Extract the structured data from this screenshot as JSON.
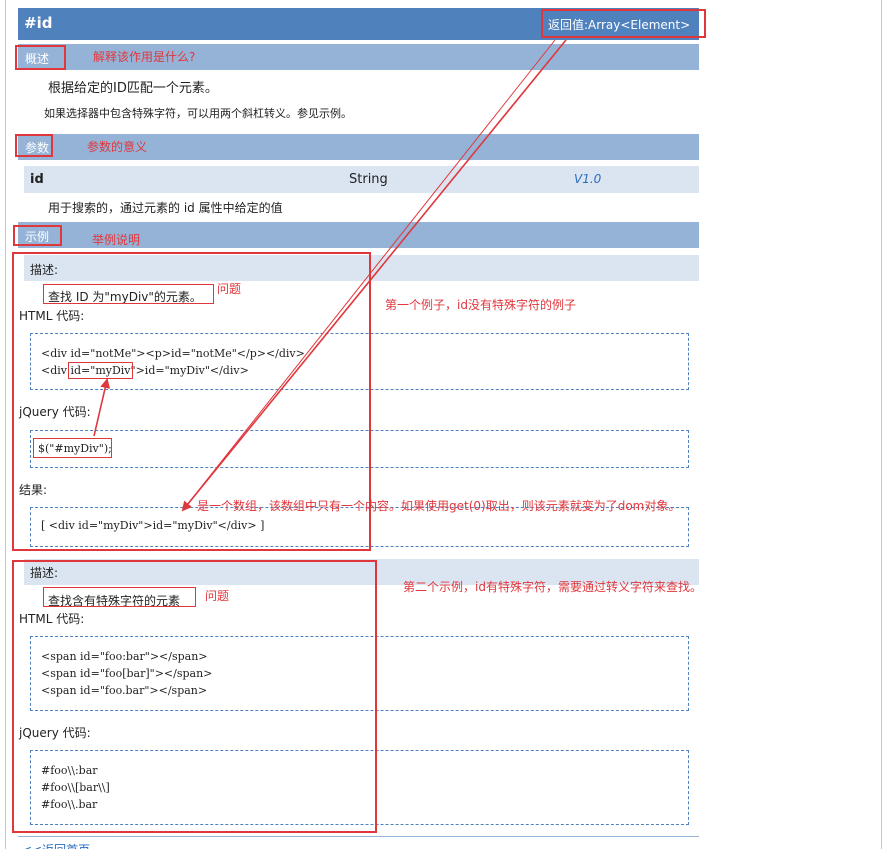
{
  "header": {
    "title": "#id",
    "return_value": "返回值:Array<Element>"
  },
  "sections": {
    "overview": "概述",
    "params": "参数",
    "examples": "示例"
  },
  "overview": {
    "line1": "根据给定的ID匹配一个元素。",
    "line2": "如果选择器中包含特殊字符，可以用两个斜杠转义。参见示例。"
  },
  "param": {
    "name": "id",
    "type": "String",
    "version": "V1.0",
    "description": "用于搜索的，通过元素的 id 属性中给定的值"
  },
  "example1": {
    "desc_label": "描述:",
    "desc_text": "查找 ID 为\"myDiv\"的元素。",
    "html_label": "HTML 代码:",
    "html_code": [
      "<div id=\"notMe\"><p>id=\"notMe\"</p></div>",
      "<div id=\"myDiv\">id=\"myDiv\"</div>"
    ],
    "jquery_label": "jQuery 代码:",
    "jquery_code": "$(\"#myDiv\");",
    "result_label": "结果:",
    "result_code": "[ <div id=\"myDiv\">id=\"myDiv\"</div> ]"
  },
  "example2": {
    "desc_label": "描述:",
    "desc_text": "查找含有特殊字符的元素",
    "html_label": "HTML 代码:",
    "html_code": [
      "<span id=\"foo:bar\"></span>",
      "<span id=\"foo[bar]\"></span>",
      "<span id=\"foo.bar\"></span>"
    ],
    "jquery_label": "jQuery 代码:",
    "jquery_code": [
      "#foo\\\\:bar",
      "#foo\\\\[bar\\\\]",
      "#foo\\\\.bar"
    ]
  },
  "annotations": {
    "overview_note": "解释该作用是什么?",
    "params_note": "参数的意义",
    "examples_note": "举例说明",
    "question1": "问题",
    "question2": "问题",
    "example1_note": "第一个例子，id没有特殊字符的例子",
    "example2_note": "第二个示例，id有特殊字符，需要通过转义字符来查找。",
    "result_note": "是一个数组，该数组中只有一个内容。如果使用get(0)取出，则该元素就变为了dom对象。"
  },
  "footer": {
    "back_link": "<<返回首页"
  },
  "colors": {
    "title_bar": "#4f81bd",
    "section_bar": "#95b3d7",
    "row_bg": "#dbe5f1",
    "annotation": "#e0373d"
  }
}
